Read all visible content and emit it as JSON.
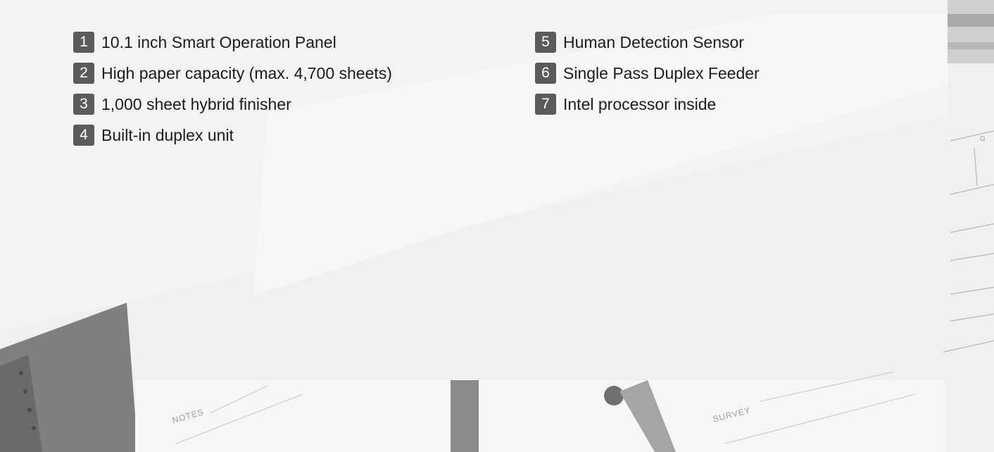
{
  "colors": {
    "badge": "#5b5b5b",
    "badge_text": "#ffffff",
    "text": "#1c1c1c",
    "background": "#f4f4f4"
  },
  "features": [
    {
      "number": "1",
      "label": "10.1 inch Smart Operation Panel"
    },
    {
      "number": "2",
      "label": "High paper capacity (max. 4,700 sheets)"
    },
    {
      "number": "3",
      "label": "1,000 sheet hybrid finisher"
    },
    {
      "number": "4",
      "label": "Built-in duplex unit"
    },
    {
      "number": "5",
      "label": "Human Detection Sensor"
    },
    {
      "number": "6",
      "label": "Single Pass Duplex Feeder"
    },
    {
      "number": "7",
      "label": "Intel processor inside"
    }
  ],
  "background_texts": {
    "notes": "NOTES",
    "survey": "SURVEY"
  }
}
